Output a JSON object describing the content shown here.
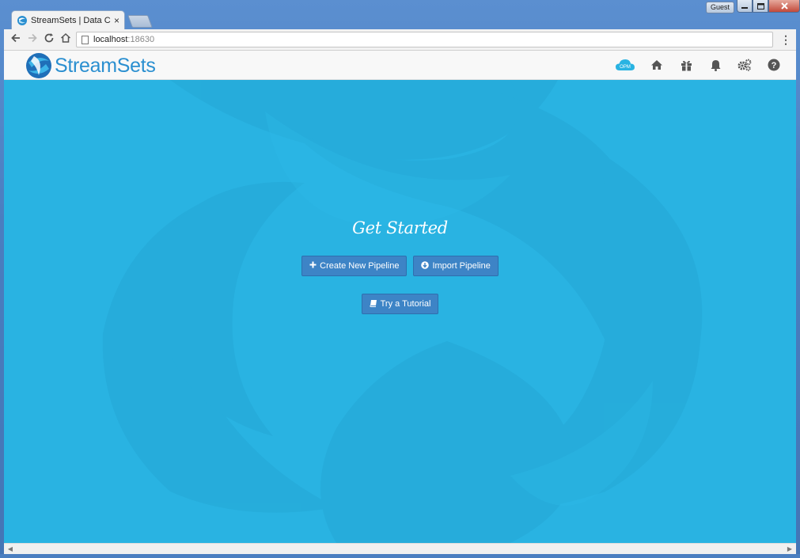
{
  "browser": {
    "tab_title": "StreamSets | Data Collector",
    "tab_close": "×",
    "profile_badge": "Guest",
    "url_host": "localhost",
    "url_port": ":18630",
    "menu_glyph": "⋮"
  },
  "header": {
    "brand_name": "StreamSets",
    "opm_label": "OPM",
    "icons": [
      "opm-cloud-icon",
      "home-icon",
      "gift-icon",
      "bell-icon",
      "gears-icon",
      "help-icon"
    ]
  },
  "main": {
    "heading": "Get Started",
    "create_pipeline_label": "Create New Pipeline",
    "import_pipeline_label": "Import Pipeline",
    "tutorial_label": "Try a Tutorial"
  },
  "colors": {
    "main_background": "#29b3e2",
    "button": "#3d84c6",
    "brand": "#2a8fd0"
  }
}
